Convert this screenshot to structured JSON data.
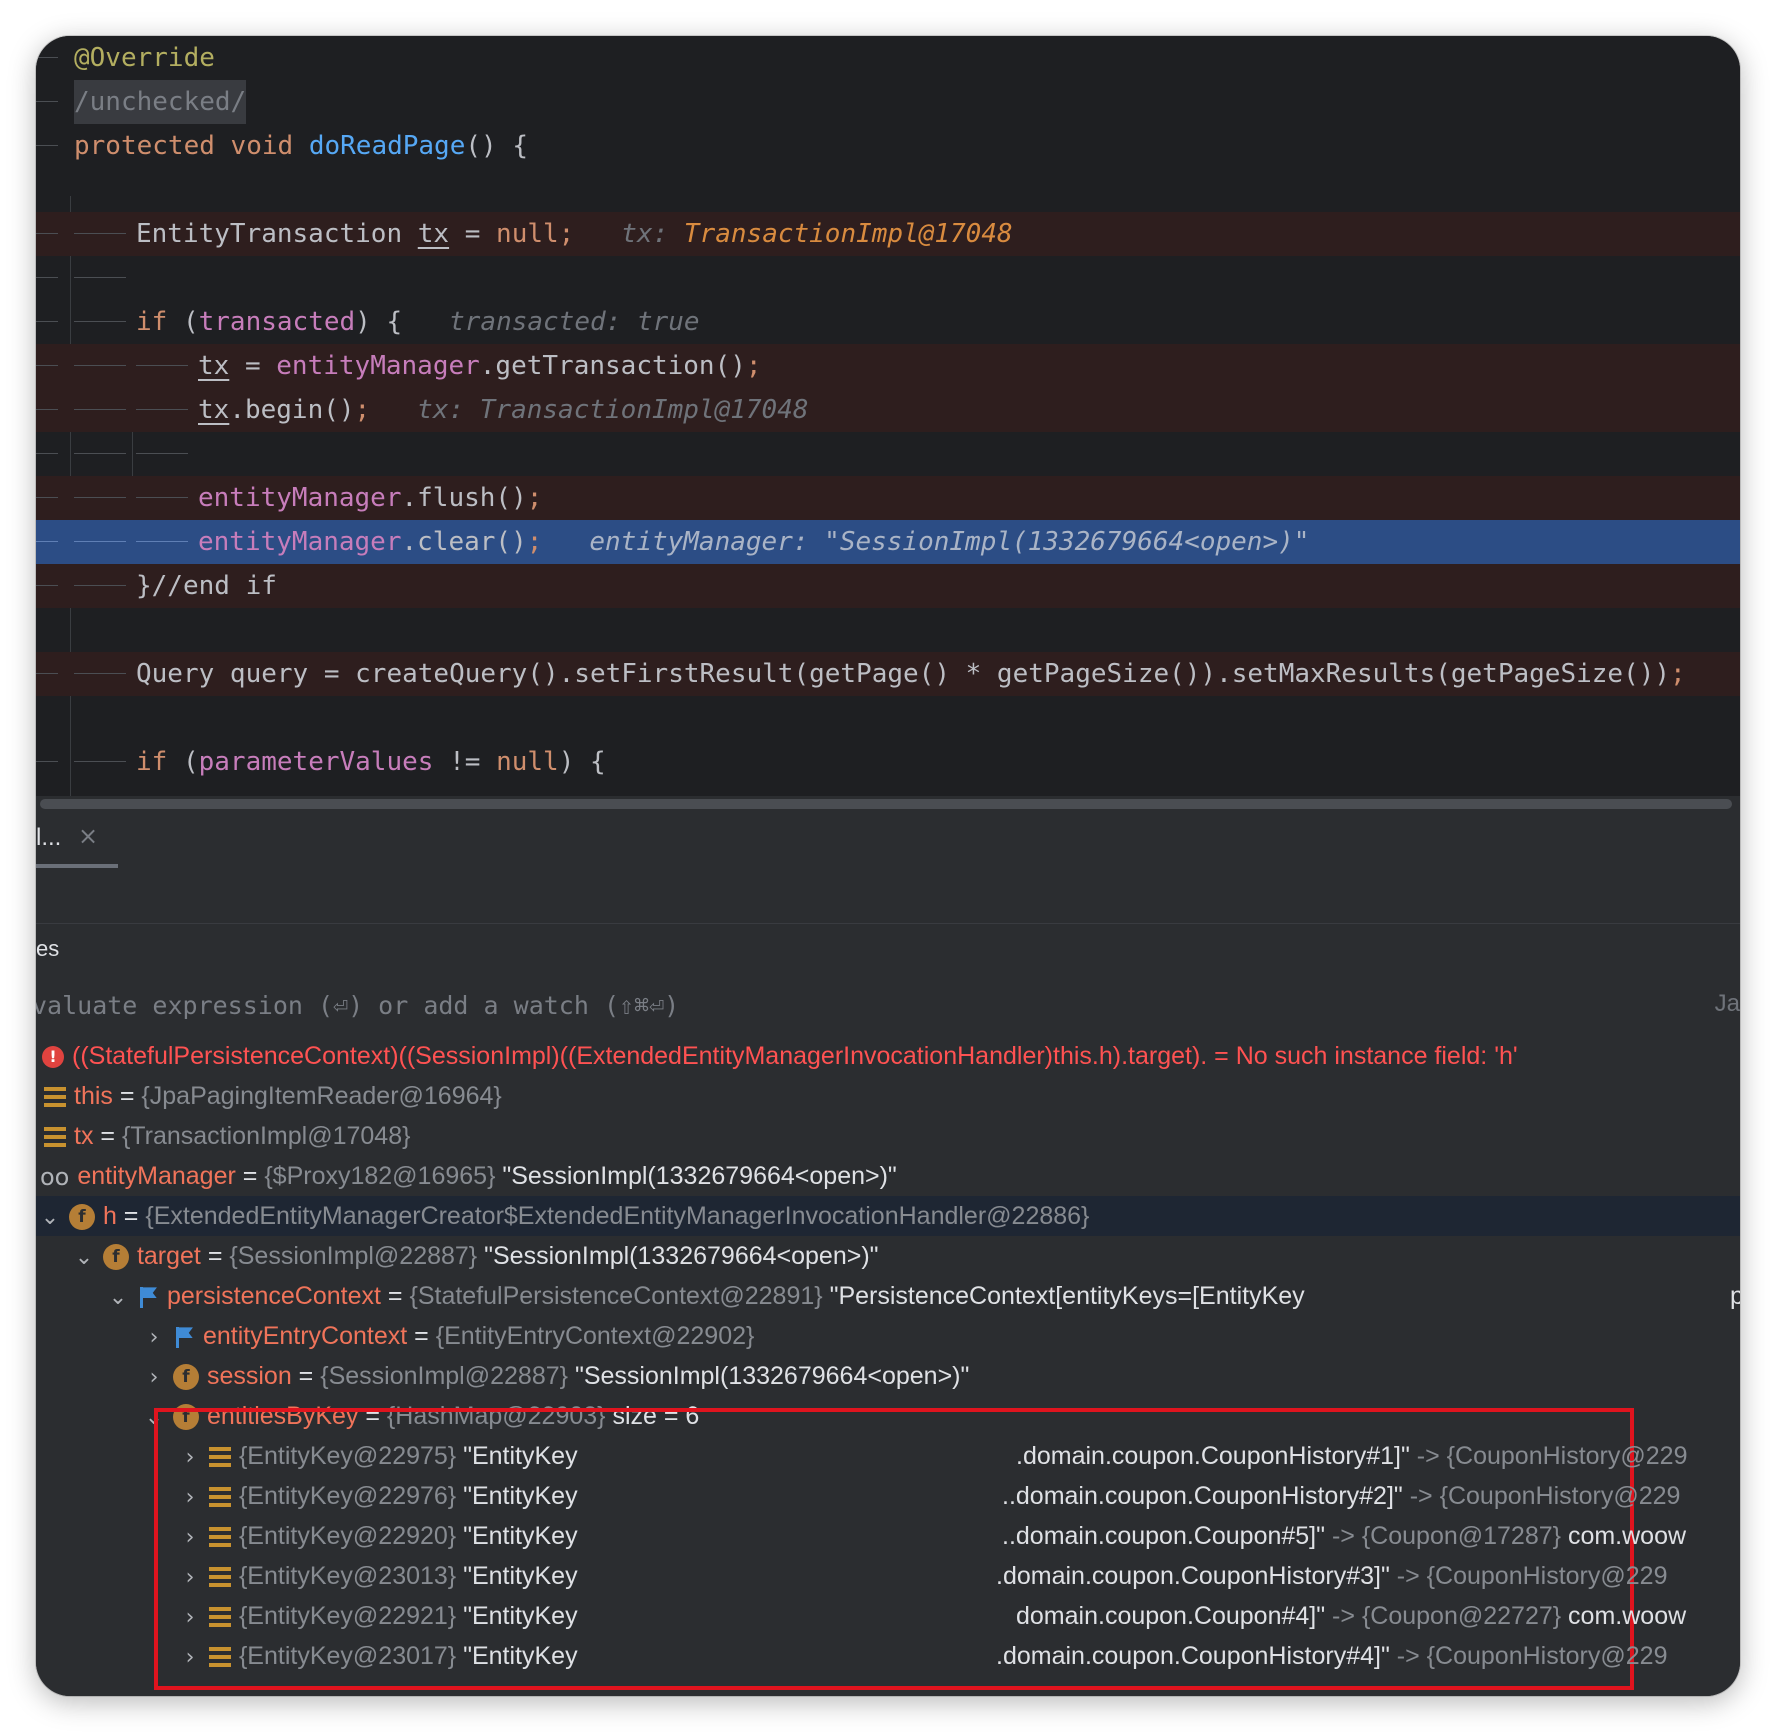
{
  "editor": {
    "annotation": "@Override",
    "comment_unchecked": "/unchecked/",
    "kw_protected": "protected",
    "kw_void": "void",
    "method_name": "doReadPage",
    "method_tail": "() {",
    "line_tx_type": "EntityTransaction ",
    "var_tx": "tx",
    "op_assign": " = ",
    "kw_null": "null",
    "semi": ";",
    "hint_tx_label": "tx: ",
    "hint_tx_value": "TransactionImpl@17048",
    "kw_if": "if",
    "transacted_open": " (",
    "transacted": "transacted",
    "transacted_close": ") {",
    "hint_transacted": "transacted: true",
    "field_entityManager": "entityManager",
    "call_getTransaction": ".getTransaction()",
    "call_begin": ".begin()",
    "hint_tx_begin": "tx: TransactionImpl@17048",
    "call_flush": ".flush()",
    "call_clear": ".clear()",
    "hint_em": "entityManager: \"SessionImpl(1332679664<open>)\"",
    "end_if": "}//end if",
    "query_line": "Query query = createQuery().setFirstResult(getPage() * getPageSize()).setMaxResults(getPageSize())",
    "kw_null2": "null",
    "param_values": "parameterValues",
    "neq": " != ",
    "open_brace": ") {"
  },
  "debug": {
    "tab_label": "l...",
    "tab_close": "×",
    "section_label": "es",
    "eval_placeholder": "valuate expression (⏎) or add a watch (⇧⌘⏎)",
    "eval_right": "Ja"
  },
  "vars": {
    "row_error": {
      "expr": "((StatefulPersistenceContext)((SessionImpl)((ExtendedEntityManagerInvocationHandler)this.h).target). = ",
      "msg": "No such instance field: 'h'"
    },
    "row_this": {
      "name": "this",
      "eq": " = ",
      "type": "{JpaPagingItemReader@16964}"
    },
    "row_tx": {
      "name": "tx",
      "eq": " = ",
      "type": "{TransactionImpl@17048}"
    },
    "row_em": {
      "name": "entityManager",
      "eq": " = ",
      "type": "{$Proxy182@16965}",
      "value": " \"SessionImpl(1332679664<open>)\""
    },
    "row_h": {
      "name": "h",
      "eq": " = ",
      "type": "{ExtendedEntityManagerCreator$ExtendedEntityManagerInvocationHandler@22886}"
    },
    "row_target": {
      "name": "target",
      "eq": " = ",
      "type": "{SessionImpl@22887}",
      "value": " \"SessionImpl(1332679664<open>)\""
    },
    "row_pc": {
      "name": "persistenceContext",
      "eq": " = ",
      "type": "{StatefulPersistenceContext@22891}",
      "value": " \"PersistenceContext[entityKeys=[EntityKey",
      "trail": "p"
    },
    "row_eec": {
      "name": "entityEntryContext",
      "eq": " = ",
      "type": "{EntityEntryContext@22902}"
    },
    "row_session": {
      "name": "session",
      "eq": " = ",
      "type": "{SessionImpl@22887}",
      "value": " \"SessionImpl(1332679664<open>)\""
    },
    "row_ebk": {
      "name": "entitiesByKey",
      "eq": " = ",
      "type": "{HashMap@22903}",
      "value": "  size = 6"
    },
    "entries": [
      {
        "key": "{EntityKey@22975}",
        "kval": " \"EntityKey",
        "tail": ".domain.coupon.CouponHistory#1]\"",
        "arrow": " -> ",
        "target": "{CouponHistory@229",
        "extra": ""
      },
      {
        "key": "{EntityKey@22976}",
        "kval": " \"EntityKey",
        "tail": "..domain.coupon.CouponHistory#2]\"",
        "arrow": " -> ",
        "target": "{CouponHistory@229",
        "extra": ""
      },
      {
        "key": "{EntityKey@22920}",
        "kval": " \"EntityKey",
        "tail": "..domain.coupon.Coupon#5]\"",
        "arrow": " -> ",
        "target": "{Coupon@17287}",
        "extra": " com.woow"
      },
      {
        "key": "{EntityKey@23013}",
        "kval": " \"EntityKey",
        "tail": ".domain.coupon.CouponHistory#3]\"",
        "arrow": " -> ",
        "target": "{CouponHistory@229",
        "extra": ""
      },
      {
        "key": "{EntityKey@22921}",
        "kval": " \"EntityKey",
        "tail": "domain.coupon.Coupon#4]\"",
        "arrow": " -> ",
        "target": "{Coupon@22727}",
        "extra": " com.woow"
      },
      {
        "key": "{EntityKey@23017}",
        "kval": " \"EntityKey",
        "tail": ".domain.coupon.CouponHistory#4]\"",
        "arrow": " -> ",
        "target": "{CouponHistory@229",
        "extra": ""
      }
    ]
  },
  "colors": {
    "highlight_box": "#e0141e",
    "current_line": "#2c4d85",
    "breakpoint_line": "#2e1e1e"
  }
}
